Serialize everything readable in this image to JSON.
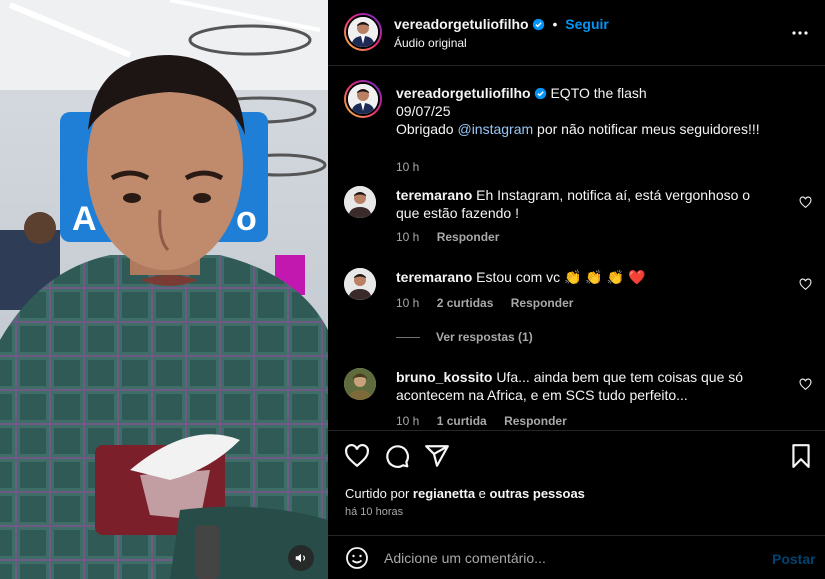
{
  "header": {
    "username": "vereadorgetuliofilho",
    "separator": "•",
    "follow_label": "Seguir",
    "audio_label": "Áudio original",
    "more_icon": "more-horizontal-icon"
  },
  "caption": {
    "username": "vereadorgetuliofilho",
    "line1": "EQTO the flash",
    "line2": "09/07/25",
    "line3_prefix": "Obrigado ",
    "mention": "@instagram",
    "line3_suffix": " por não notificar meus seguidores!!!",
    "time": "10 h"
  },
  "comments": [
    {
      "username": "teremarano",
      "text": "Eh Instagram, notifica aí, está vergonhoso o que estão fazendo !",
      "time": "10 h",
      "likes": "",
      "reply_label": "Responder"
    },
    {
      "username": "teremarano",
      "text": "Estou com vc 👏 👏 👏 ❤️",
      "time": "10 h",
      "likes": "2 curtidas",
      "reply_label": "Responder"
    },
    {
      "username": "bruno_kossito",
      "text": "Ufa... ainda bem que tem coisas que só acontecem na Africa, e em SCS tudo perfeito...",
      "time": "10 h",
      "likes": "1 curtida",
      "reply_label": "Responder"
    }
  ],
  "view_replies": "Ver respostas (1)",
  "likes": {
    "prefix": "Curtido por ",
    "user": "regianetta",
    "middle": " e ",
    "others": "outras pessoas",
    "ago": "há 10 horas"
  },
  "composer": {
    "placeholder": "Adicione um comentário...",
    "post_label": "Postar"
  },
  "colors": {
    "accent": "#0095f6",
    "heart": "#ff3040"
  }
}
